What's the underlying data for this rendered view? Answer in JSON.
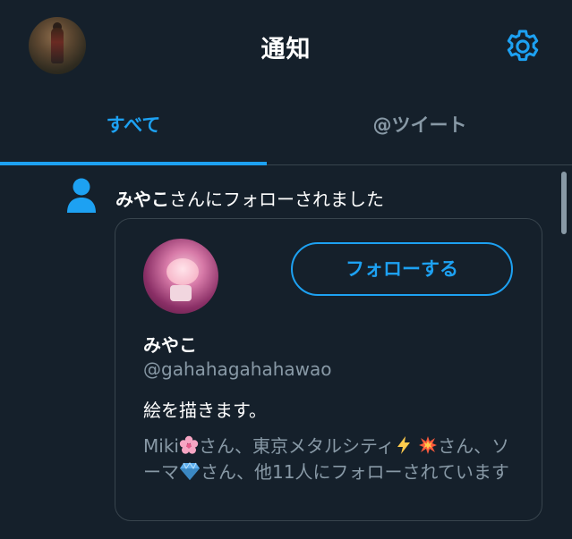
{
  "header": {
    "title": "通知",
    "avatar_icon": "user-avatar-photo",
    "settings_icon": "gear-icon"
  },
  "tabs": [
    {
      "label": "すべて",
      "active": true
    },
    {
      "label": "@ツイート",
      "active": false
    }
  ],
  "notification": {
    "icon": "person-icon",
    "actor": "みやこ",
    "message": "さんにフォローされました",
    "card": {
      "name": "みやこ",
      "handle": "@gahahagahahawao",
      "bio": "絵を描きます。",
      "follow_label": "フォローする",
      "followed_by": {
        "name1": "Miki",
        "name2": "東京メタルシティ",
        "name3": "ソーマ",
        "san": "さん",
        "separator": "、",
        "others": "他11人にフォローされています"
      }
    }
  },
  "colors": {
    "background": "#15202b",
    "accent": "#1da1f2",
    "secondary_text": "#8899a6",
    "border": "#38444d"
  }
}
